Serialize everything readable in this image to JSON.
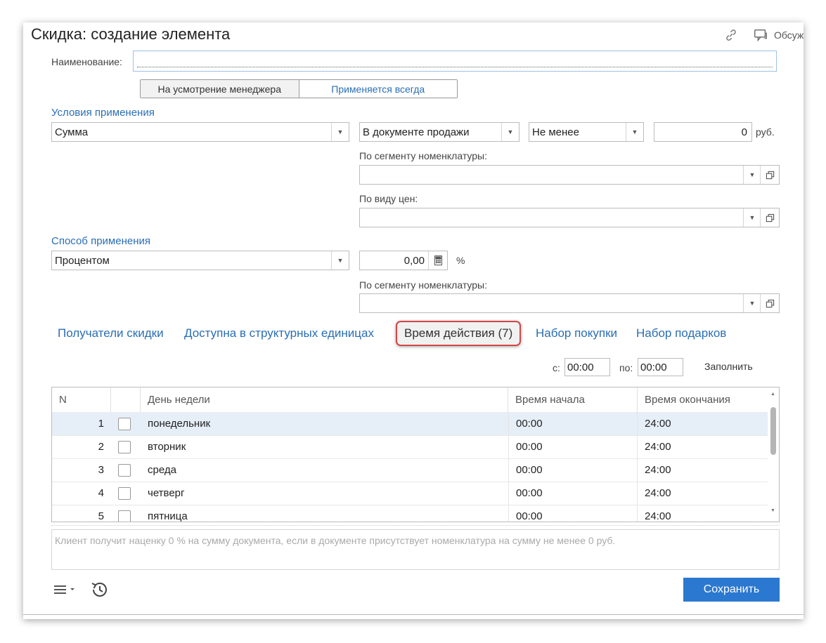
{
  "header": {
    "title": "Скидка: создание элемента",
    "discuss_label": "Обсуждение"
  },
  "form": {
    "name_label": "Наименование:",
    "name_value": "",
    "mode_buttons": [
      "На усмотрение менеджера",
      "Применяется всегда"
    ],
    "conditions_title": "Условия применения",
    "condition_type": "Сумма",
    "condition_scope": "В документе продажи",
    "condition_compare": "Не менее",
    "condition_amount": "0",
    "currency": "руб.",
    "segment_label": "По сегменту номенклатуры:",
    "segment_value": "",
    "price_type_label": "По виду цен:",
    "price_type_value": "",
    "method_title": "Способ применения",
    "method_type": "Процентом",
    "method_value": "0,00",
    "percent_sign": "%",
    "method_segment_label": "По сегменту номенклатуры:",
    "method_segment_value": ""
  },
  "tabs": [
    {
      "label": "Получатели скидки",
      "active": false
    },
    {
      "label": "Доступна в структурных единицах",
      "active": false
    },
    {
      "label": "Время действия (7)",
      "active": true
    },
    {
      "label": "Набор покупки",
      "active": false
    },
    {
      "label": "Набор подарков",
      "active": false
    }
  ],
  "time_filter": {
    "from_label": "с:",
    "from_value": "00:00",
    "to_label": "по:",
    "to_value": "00:00",
    "fill_label": "Заполнить"
  },
  "grid": {
    "columns": [
      "N",
      "",
      "День недели",
      "Время начала",
      "Время окончания"
    ],
    "rows": [
      {
        "n": "1",
        "day": "понедельник",
        "start": "00:00",
        "end": "24:00",
        "selected": true
      },
      {
        "n": "2",
        "day": "вторник",
        "start": "00:00",
        "end": "24:00",
        "selected": false
      },
      {
        "n": "3",
        "day": "среда",
        "start": "00:00",
        "end": "24:00",
        "selected": false
      },
      {
        "n": "4",
        "day": "четверг",
        "start": "00:00",
        "end": "24:00",
        "selected": false
      },
      {
        "n": "5",
        "day": "пятница",
        "start": "00:00",
        "end": "24:00",
        "selected": false
      }
    ]
  },
  "note": "Клиент получит наценку 0 % на сумму документа, если в документе присутствует номенклатура на сумму не менее 0 руб.",
  "footer": {
    "save_label": "Сохранить"
  },
  "colors": {
    "accent": "#2a6eb5",
    "save_button": "#2b78d0",
    "active_tab_border": "#d64545",
    "selected_row": "#e6eef7"
  }
}
